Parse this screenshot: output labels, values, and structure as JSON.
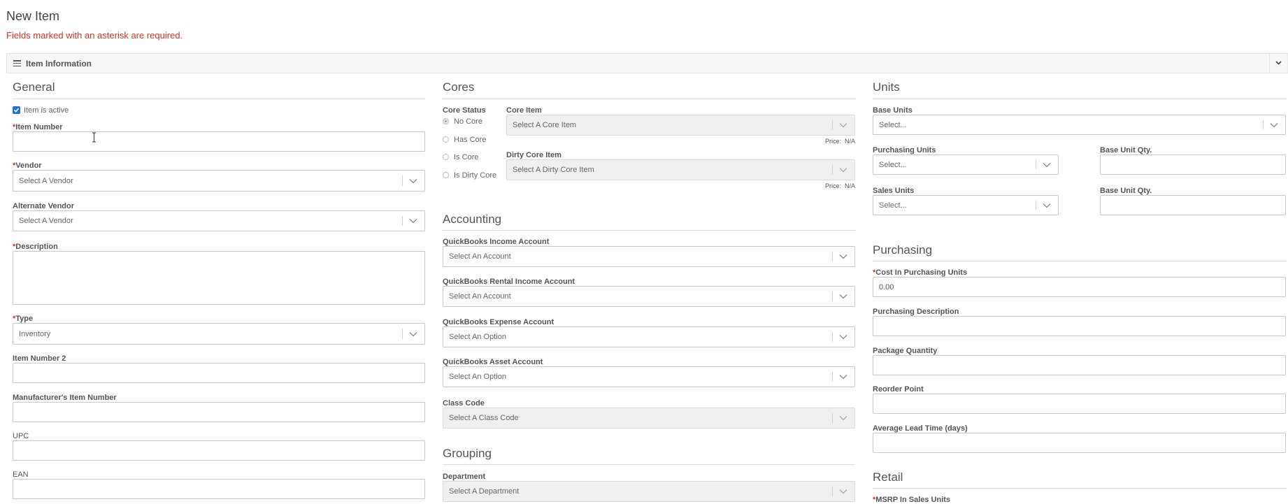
{
  "page": {
    "title": "New Item",
    "required_note": "Fields marked with an asterisk are required."
  },
  "panel": {
    "title": "Item Information"
  },
  "general": {
    "title": "General",
    "active_label": "Item is active",
    "active": true,
    "item_number": {
      "label": "Item Number",
      "value": ""
    },
    "vendor": {
      "label": "Vendor",
      "value": "Select A Vendor"
    },
    "alt_vendor": {
      "label": "Alternate Vendor",
      "value": "Select A Vendor"
    },
    "description": {
      "label": "Description",
      "value": ""
    },
    "type": {
      "label": "Type",
      "value": "Inventory"
    },
    "item_number_2": {
      "label": "Item Number 2",
      "value": ""
    },
    "manufacturer_item_number": {
      "label": "Manufacturer's Item Number",
      "value": ""
    },
    "upc": {
      "label": "UPC",
      "value": ""
    },
    "ean": {
      "label": "EAN",
      "value": ""
    }
  },
  "cores": {
    "title": "Cores",
    "status_label": "Core Status",
    "status_options": [
      "No Core",
      "Has Core",
      "Is Core",
      "Is Dirty Core"
    ],
    "status_selected": "No Core",
    "core_item": {
      "label": "Core Item",
      "value": "Select A Core Item",
      "price_label": "Price:",
      "price_value": "N/A"
    },
    "dirty_core_item": {
      "label": "Dirty Core Item",
      "value": "Select A Dirty Core Item",
      "price_label": "Price:",
      "price_value": "N/A"
    }
  },
  "accounting": {
    "title": "Accounting",
    "income": {
      "label": "QuickBooks Income Account",
      "value": "Select An Account"
    },
    "rental_income": {
      "label": "QuickBooks Rental Income Account",
      "value": "Select An Account"
    },
    "expense": {
      "label": "QuickBooks Expense Account",
      "value": "Select An Option"
    },
    "asset": {
      "label": "QuickBooks Asset Account",
      "value": "Select An Option"
    },
    "class_code": {
      "label": "Class Code",
      "value": "Select A Class Code"
    }
  },
  "grouping": {
    "title": "Grouping",
    "department": {
      "label": "Department",
      "value": "Select A Department"
    }
  },
  "units": {
    "title": "Units",
    "base_units": {
      "label": "Base Units",
      "value": "Select..."
    },
    "purchasing_units": {
      "label": "Purchasing Units",
      "value": "Select..."
    },
    "purchasing_qty": {
      "label": "Base Unit Qty.",
      "value": ""
    },
    "sales_units": {
      "label": "Sales Units",
      "value": "Select..."
    },
    "sales_qty": {
      "label": "Base Unit Qty.",
      "value": ""
    }
  },
  "purchasing": {
    "title": "Purchasing",
    "cost": {
      "label": "Cost In Purchasing Units",
      "value": "0.00"
    },
    "description": {
      "label": "Purchasing Description",
      "value": ""
    },
    "package_qty": {
      "label": "Package Quantity",
      "value": ""
    },
    "reorder_point": {
      "label": "Reorder Point",
      "value": ""
    },
    "lead_time": {
      "label": "Average Lead Time (days)",
      "value": ""
    }
  },
  "retail": {
    "title": "Retail",
    "msrp": {
      "label": "MSRP In Sales Units"
    }
  },
  "colors": {
    "required": "#d9301c",
    "checkbox": "#1a73d9"
  },
  "icons": {
    "panel_menu": "hamburger-icon",
    "panel_toggle": "chevron-down-icon",
    "select_toggle": "chevron-down-icon",
    "cursor": "text-cursor-icon"
  }
}
